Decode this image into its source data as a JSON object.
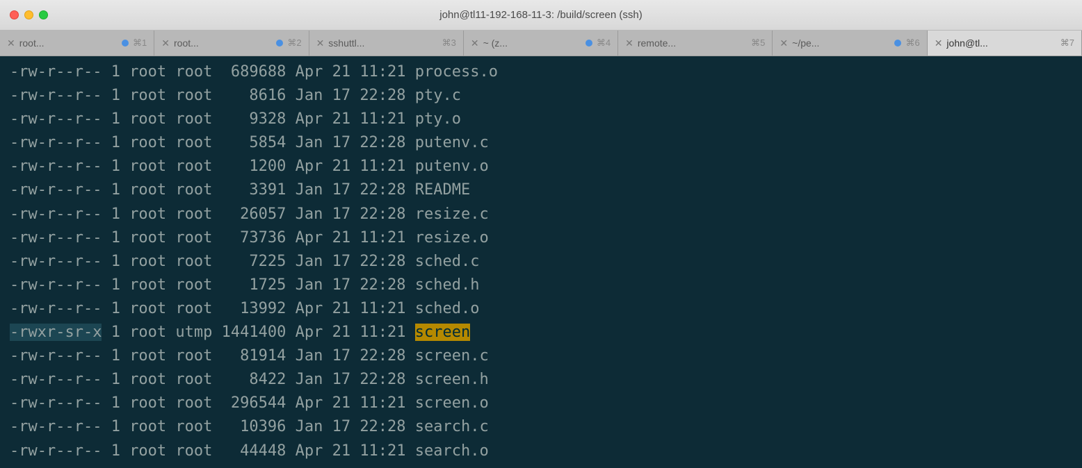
{
  "window": {
    "title": "john@tl11-192-168-11-3: /build/screen (ssh)"
  },
  "tabs": [
    {
      "label": "root...",
      "dot": true,
      "shortcut": "⌘1",
      "active": false
    },
    {
      "label": "root...",
      "dot": true,
      "shortcut": "⌘2",
      "active": false
    },
    {
      "label": "sshuttl...",
      "dot": false,
      "shortcut": "⌘3",
      "active": false
    },
    {
      "label": "~ (z...",
      "dot": true,
      "shortcut": "⌘4",
      "active": false
    },
    {
      "label": "remote...",
      "dot": false,
      "shortcut": "⌘5",
      "active": false
    },
    {
      "label": "~/pe...",
      "dot": true,
      "shortcut": "⌘6",
      "active": false
    },
    {
      "label": "john@tl...",
      "dot": false,
      "shortcut": "⌘7",
      "active": true
    }
  ],
  "listing": [
    {
      "perms": "-rw-r--r--",
      "links": "1",
      "owner": "root",
      "group": "root",
      "size": "689688",
      "month": "Apr",
      "day": "21",
      "time": "11:21",
      "name": "process.o",
      "hl": false
    },
    {
      "perms": "-rw-r--r--",
      "links": "1",
      "owner": "root",
      "group": "root",
      "size": "8616",
      "month": "Jan",
      "day": "17",
      "time": "22:28",
      "name": "pty.c",
      "hl": false
    },
    {
      "perms": "-rw-r--r--",
      "links": "1",
      "owner": "root",
      "group": "root",
      "size": "9328",
      "month": "Apr",
      "day": "21",
      "time": "11:21",
      "name": "pty.o",
      "hl": false
    },
    {
      "perms": "-rw-r--r--",
      "links": "1",
      "owner": "root",
      "group": "root",
      "size": "5854",
      "month": "Jan",
      "day": "17",
      "time": "22:28",
      "name": "putenv.c",
      "hl": false
    },
    {
      "perms": "-rw-r--r--",
      "links": "1",
      "owner": "root",
      "group": "root",
      "size": "1200",
      "month": "Apr",
      "day": "21",
      "time": "11:21",
      "name": "putenv.o",
      "hl": false
    },
    {
      "perms": "-rw-r--r--",
      "links": "1",
      "owner": "root",
      "group": "root",
      "size": "3391",
      "month": "Jan",
      "day": "17",
      "time": "22:28",
      "name": "README",
      "hl": false
    },
    {
      "perms": "-rw-r--r--",
      "links": "1",
      "owner": "root",
      "group": "root",
      "size": "26057",
      "month": "Jan",
      "day": "17",
      "time": "22:28",
      "name": "resize.c",
      "hl": false
    },
    {
      "perms": "-rw-r--r--",
      "links": "1",
      "owner": "root",
      "group": "root",
      "size": "73736",
      "month": "Apr",
      "day": "21",
      "time": "11:21",
      "name": "resize.o",
      "hl": false
    },
    {
      "perms": "-rw-r--r--",
      "links": "1",
      "owner": "root",
      "group": "root",
      "size": "7225",
      "month": "Jan",
      "day": "17",
      "time": "22:28",
      "name": "sched.c",
      "hl": false
    },
    {
      "perms": "-rw-r--r--",
      "links": "1",
      "owner": "root",
      "group": "root",
      "size": "1725",
      "month": "Jan",
      "day": "17",
      "time": "22:28",
      "name": "sched.h",
      "hl": false
    },
    {
      "perms": "-rw-r--r--",
      "links": "1",
      "owner": "root",
      "group": "root",
      "size": "13992",
      "month": "Apr",
      "day": "21",
      "time": "11:21",
      "name": "sched.o",
      "hl": false
    },
    {
      "perms": "-rwxr-sr-x",
      "links": "1",
      "owner": "root",
      "group": "utmp",
      "size": "1441400",
      "month": "Apr",
      "day": "21",
      "time": "11:21",
      "name": "screen",
      "hl": true
    },
    {
      "perms": "-rw-r--r--",
      "links": "1",
      "owner": "root",
      "group": "root",
      "size": "81914",
      "month": "Jan",
      "day": "17",
      "time": "22:28",
      "name": "screen.c",
      "hl": false
    },
    {
      "perms": "-rw-r--r--",
      "links": "1",
      "owner": "root",
      "group": "root",
      "size": "8422",
      "month": "Jan",
      "day": "17",
      "time": "22:28",
      "name": "screen.h",
      "hl": false
    },
    {
      "perms": "-rw-r--r--",
      "links": "1",
      "owner": "root",
      "group": "root",
      "size": "296544",
      "month": "Apr",
      "day": "21",
      "time": "11:21",
      "name": "screen.o",
      "hl": false
    },
    {
      "perms": "-rw-r--r--",
      "links": "1",
      "owner": "root",
      "group": "root",
      "size": "10396",
      "month": "Jan",
      "day": "17",
      "time": "22:28",
      "name": "search.c",
      "hl": false
    },
    {
      "perms": "-rw-r--r--",
      "links": "1",
      "owner": "root",
      "group": "root",
      "size": "44448",
      "month": "Apr",
      "day": "21",
      "time": "11:21",
      "name": "search.o",
      "hl": false
    }
  ]
}
